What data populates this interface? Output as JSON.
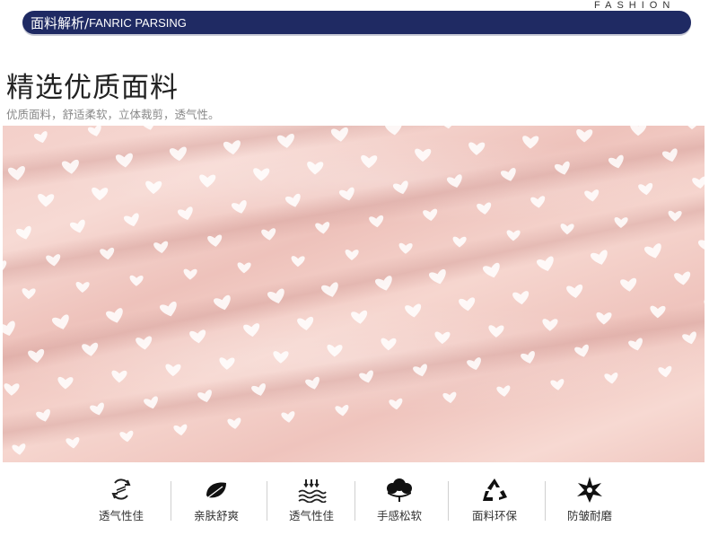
{
  "header": {
    "fashion_tag": "FASHION",
    "title_cn": "面料解析/",
    "title_en": "FANRIC PARSING"
  },
  "section": {
    "title": "精选优质面料",
    "subtitle": "优质面料，舒适柔软，立体裁剪，透气性。"
  },
  "fabric_image": {
    "base_color": "#f3cfc9",
    "pattern_color": "#ffffff",
    "pattern": "hearts"
  },
  "features": [
    {
      "icon": "airflow-icon",
      "label": "透气性佳"
    },
    {
      "icon": "leaf-icon",
      "label": "亲肤舒爽"
    },
    {
      "icon": "steam-wave-icon",
      "label": "透气性佳"
    },
    {
      "icon": "cotton-flower-icon",
      "label": "手感松软"
    },
    {
      "icon": "recycle-icon",
      "label": "面料环保"
    },
    {
      "icon": "star-burst-icon",
      "label": "防皱耐磨"
    }
  ],
  "colors": {
    "header_bar": "#1f2a63",
    "text_dark": "#222222",
    "text_muted": "#888888"
  }
}
